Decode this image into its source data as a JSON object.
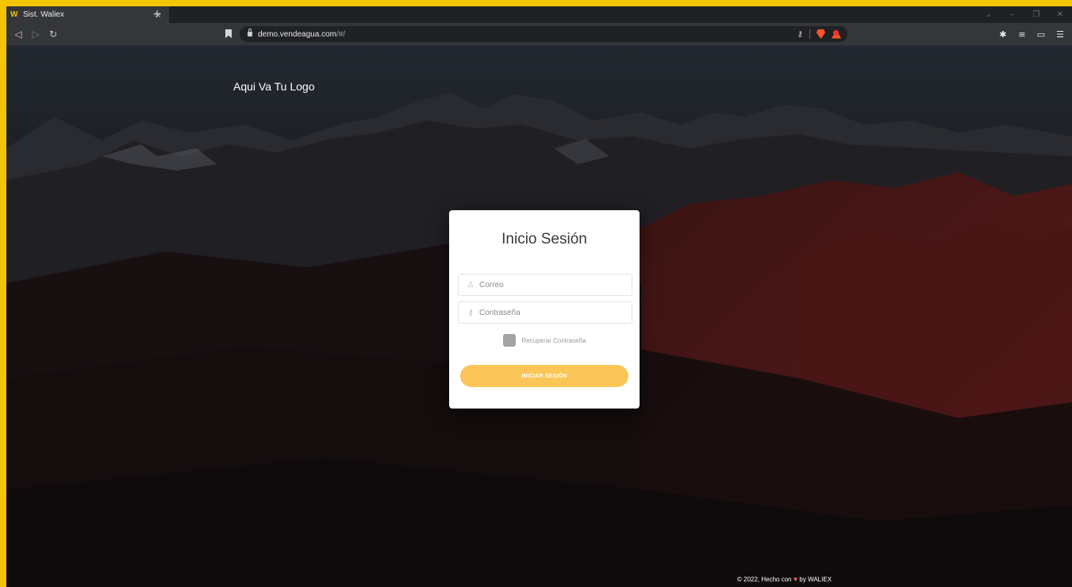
{
  "browser": {
    "tab_title": "Sist. Waliex",
    "tab_favicon": "W",
    "tab_close": "×",
    "new_tab": "+",
    "url_host": "demo.vendeagua.com",
    "url_path": "/#/"
  },
  "icons": {
    "back": "back-arrow-icon",
    "forward": "forward-arrow-icon",
    "reload": "reload-icon",
    "bookmark": "bookmark-icon",
    "lock": "lock-icon",
    "key": "key-icon",
    "brave_shield": "brave-shield-icon",
    "rewards": "brave-rewards-icon",
    "extensions": "puzzle-icon",
    "playlist": "playlist-icon",
    "wallet": "wallet-icon",
    "menu": "menu-icon",
    "user": "user-icon",
    "password": "key-icon",
    "heart": "heart-icon"
  },
  "page": {
    "logo_text": "Aqui Va Tu Logo",
    "login": {
      "title": "Inicio Sesión",
      "email_placeholder": "Correo",
      "password_placeholder": "Contraseña",
      "recover_label": "Recuperar Contraseña",
      "submit_label": "INICIAR SESIÓN"
    },
    "footer": {
      "prefix": "© 2022, Hecho con",
      "suffix": "by WALIEX"
    }
  },
  "colors": {
    "window_border": "#f2c500",
    "button_bg": "#fbc658",
    "heart": "#f05d5e"
  }
}
